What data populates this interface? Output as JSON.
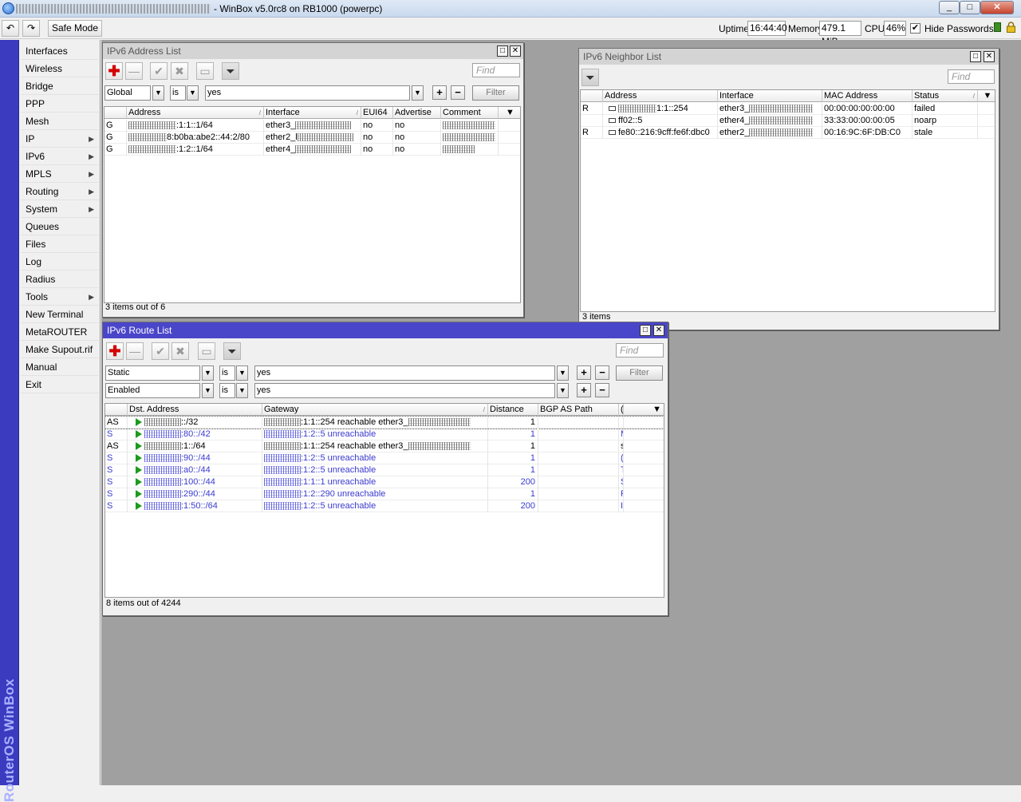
{
  "titlebar": {
    "title": "- WinBox v5.0rc8 on RB1000 (powerpc)",
    "minimize": "_",
    "maximize": "□",
    "close": "✕"
  },
  "toolbar": {
    "undo_icon": "↶",
    "redo_icon": "↷",
    "safe_mode": "Safe Mode",
    "uptime_label": "Uptime:",
    "uptime": "16:44:40",
    "memory_label": "Memory:",
    "memory": "479.1 MiB",
    "cpu_label": "CPU:",
    "cpu": "46%",
    "hide_passwords": "Hide Passwords",
    "hide_passwords_checked": "✔"
  },
  "sidebar": {
    "brand": "RouterOS WinBox",
    "items": [
      {
        "label": "Interfaces",
        "sub": ""
      },
      {
        "label": "Wireless",
        "sub": ""
      },
      {
        "label": "Bridge",
        "sub": ""
      },
      {
        "label": "PPP",
        "sub": ""
      },
      {
        "label": "Mesh",
        "sub": ""
      },
      {
        "label": "IP",
        "sub": "▶"
      },
      {
        "label": "IPv6",
        "sub": "▶"
      },
      {
        "label": "MPLS",
        "sub": "▶"
      },
      {
        "label": "Routing",
        "sub": "▶"
      },
      {
        "label": "System",
        "sub": "▶"
      },
      {
        "label": "Queues",
        "sub": ""
      },
      {
        "label": "Files",
        "sub": ""
      },
      {
        "label": "Log",
        "sub": ""
      },
      {
        "label": "Radius",
        "sub": ""
      },
      {
        "label": "Tools",
        "sub": "▶"
      },
      {
        "label": "New Terminal",
        "sub": ""
      },
      {
        "label": "MetaROUTER",
        "sub": ""
      },
      {
        "label": "Make Supout.rif",
        "sub": ""
      },
      {
        "label": "Manual",
        "sub": ""
      },
      {
        "label": "Exit",
        "sub": ""
      }
    ]
  },
  "addr_win": {
    "title": "IPv6 Address List",
    "find": "Find",
    "filter": {
      "field": "Global",
      "op": "is",
      "value": "yes",
      "button": "Filter"
    },
    "columns": [
      "Address",
      "Interface",
      "EUI64",
      "Advertise",
      "Comment"
    ],
    "rows": [
      {
        "flag": "G",
        "address": ":1:1::1/64",
        "iface": "ether3_",
        "eui": "no",
        "adv": "no"
      },
      {
        "flag": "G",
        "address": "8:b0ba:abe2::44:2/80",
        "iface": "ether2_l",
        "eui": "no",
        "adv": "no"
      },
      {
        "flag": "G",
        "address": ":1:2::1/64",
        "iface": "ether4_",
        "eui": "no",
        "adv": "no"
      }
    ],
    "status": "3 items out of 6"
  },
  "neigh_win": {
    "title": "IPv6 Neighbor List",
    "find": "Find",
    "columns": [
      "Address",
      "Interface",
      "MAC Address",
      "Status"
    ],
    "rows": [
      {
        "flag": "R",
        "address": "1:1::254",
        "iface": "ether3_",
        "mac": "00:00:00:00:00:00",
        "status": "failed"
      },
      {
        "flag": "",
        "address": "ff02::5",
        "iface": "ether4_",
        "mac": "33:33:00:00:00:05",
        "status": "noarp"
      },
      {
        "flag": "R",
        "address": "fe80::216:9cff:fe6f:dbc0",
        "iface": "ether2_",
        "mac": "00:16:9C:6F:DB:C0",
        "status": "stale"
      }
    ],
    "status": "3 items"
  },
  "route_win": {
    "title": "IPv6 Route List",
    "find": "Find",
    "filter1": {
      "field": "Static",
      "op": "is",
      "value": "yes"
    },
    "filter2": {
      "field": "Enabled",
      "op": "is",
      "value": "yes"
    },
    "filter_button": "Filter",
    "columns": [
      "Dst. Address",
      "Gateway",
      "Distance",
      "BGP AS Path",
      "("
    ],
    "rows": [
      {
        "flag": "AS",
        "dst": "::/32",
        "gw": ":1:1::254 reachable ether3_",
        "dist": "1",
        "extra": "",
        "unreach": false
      },
      {
        "flag": "S",
        "dst": ":80::/42",
        "gw": ":1:2::5 unreachable",
        "dist": "1",
        "extra": "M",
        "unreach": true
      },
      {
        "flag": "AS",
        "dst": ":1::/64",
        "gw": ":1:1::254 reachable ether3_",
        "dist": "1",
        "extra": "s",
        "unreach": false
      },
      {
        "flag": "S",
        "dst": ":90::/44",
        "gw": ":1:2::5 unreachable",
        "dist": "1",
        "extra": "(",
        "unreach": true
      },
      {
        "flag": "S",
        "dst": ":a0::/44",
        "gw": ":1:2::5 unreachable",
        "dist": "1",
        "extra": "T",
        "unreach": true
      },
      {
        "flag": "S",
        "dst": ":100::/44",
        "gw": ":1:1::1 unreachable",
        "dist": "200",
        "extra": "S",
        "unreach": true
      },
      {
        "flag": "S",
        "dst": ":290::/44",
        "gw": ":1:2::290 unreachable",
        "dist": "1",
        "extra": "F",
        "unreach": true
      },
      {
        "flag": "S",
        "dst": ":1:50::/64",
        "gw": ":1:2::5 unreachable",
        "dist": "200",
        "extra": "I",
        "unreach": true
      }
    ],
    "status": "8 items out of 4244"
  }
}
